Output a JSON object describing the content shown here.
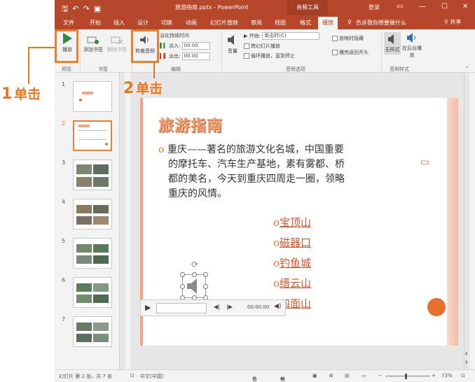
{
  "annotations": {
    "step1": {
      "num": "1",
      "text": "单击"
    },
    "step2": {
      "num": "2",
      "text": "单击"
    }
  },
  "titlebar": {
    "qat_icons": [
      "save-icon",
      "undo-icon",
      "redo-icon",
      "start-from-beginning-icon"
    ],
    "document_title": "旅游指南.pptx - PowerPoint",
    "context_tab_group": "音频工具",
    "login": "登录",
    "window_controls": [
      "ribbon-display-icon",
      "minimize-icon",
      "maximize-icon",
      "close-icon"
    ]
  },
  "tabs": {
    "file": "文件",
    "home": "开始",
    "insert": "插入",
    "design": "设计",
    "transitions": "切换",
    "animations": "动画",
    "slideshow": "幻灯片放映",
    "review": "审阅",
    "view": "视图",
    "format": "格式",
    "playback": "播放",
    "tell_me": "告诉我你想要做什么",
    "share": "共享"
  },
  "ribbon": {
    "play": "播放",
    "add_bookmark": "添加书签",
    "remove_bookmark": "删除书签",
    "trim_audio": "剪裁音频",
    "fade_duration": "淡化持续时间",
    "fade_in_label": "淡入:",
    "fade_in_value": "00.00",
    "fade_out_label": "淡出:",
    "fade_out_value": "00.00",
    "volume": "音量",
    "start_label": "开始:",
    "start_value": "单击时(C)",
    "play_across_slides": "跨幻灯片播放",
    "loop_until_stopped": "循环播放，直到停止",
    "hide_during_show": "放映时隐藏",
    "rewind_after_playing": "播完返回开头",
    "no_style": "无样式",
    "play_in_background": "在后台播放",
    "groups": {
      "preview": "预览",
      "bookmarks": "书签",
      "editing": "编辑",
      "audio_options": "音频选项",
      "audio_styles": "音频样式"
    }
  },
  "thumbnails": [
    "1",
    "2",
    "3",
    "4",
    "5",
    "6",
    "7"
  ],
  "slide": {
    "title": "旅游指南",
    "paragraph": [
      "重庆——著名的旅游文化名城，中国重要",
      "的摩托车、汽车生产基地，素有雾都、桥",
      "都的美名，今天到重庆四周走一圈，领略",
      "重庆的风情。"
    ],
    "links": [
      "宝顶山",
      "磁器口",
      "钓鱼城",
      "缙云山",
      "四面山"
    ],
    "player_time": "00:00.00"
  },
  "statusbar": {
    "slide_info": "幻灯片 第 2 张，共 7 张",
    "language": "中文(中国)",
    "notes": "备注",
    "comments": "批注",
    "zoom": "73%"
  },
  "colors": {
    "accent": "#b7472a",
    "highlight": "#e8812b",
    "title": "#f0a070",
    "link": "#d9542a"
  }
}
